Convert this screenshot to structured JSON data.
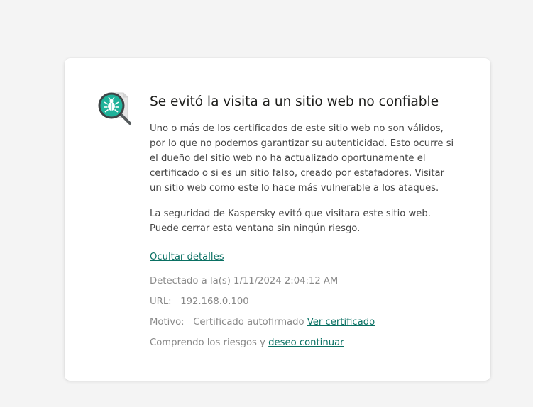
{
  "colors": {
    "page_background": "#f4f4f4",
    "card_background": "#ffffff",
    "accent": "#0a7063",
    "icon_teal": "#1fb29a"
  },
  "icon": {
    "name": "magnifier-bug-icon"
  },
  "warning": {
    "title": "Se evitó la visita a un sitio web no confiable",
    "paragraph1": "Uno o más de los certificados de este sitio web no son válidos, por lo que no podemos garantizar su autenticidad. Esto ocurre si el dueño del sitio web no ha actualizado oportunamente el certificado o si es un sitio falso, creado por estafadores. Visitar un sitio web como este lo hace más vulnerable a los ataques.",
    "paragraph2": "La seguridad de Kaspersky evitó que visitara este sitio web. Puede cerrar esta ventana sin ningún riesgo.",
    "toggle_details_label": "Ocultar detalles"
  },
  "details": {
    "detected": "Detectado a la(s) 1/11/2024 2:04:12 AM",
    "url_label": "URL:",
    "url_value": "192.168.0.100",
    "reason_label": "Motivo:",
    "reason_value": "Certificado autofirmado",
    "view_certificate_label": "Ver certificado",
    "continue_prefix": "Comprendo los riesgos y",
    "continue_label": "deseo continuar"
  }
}
